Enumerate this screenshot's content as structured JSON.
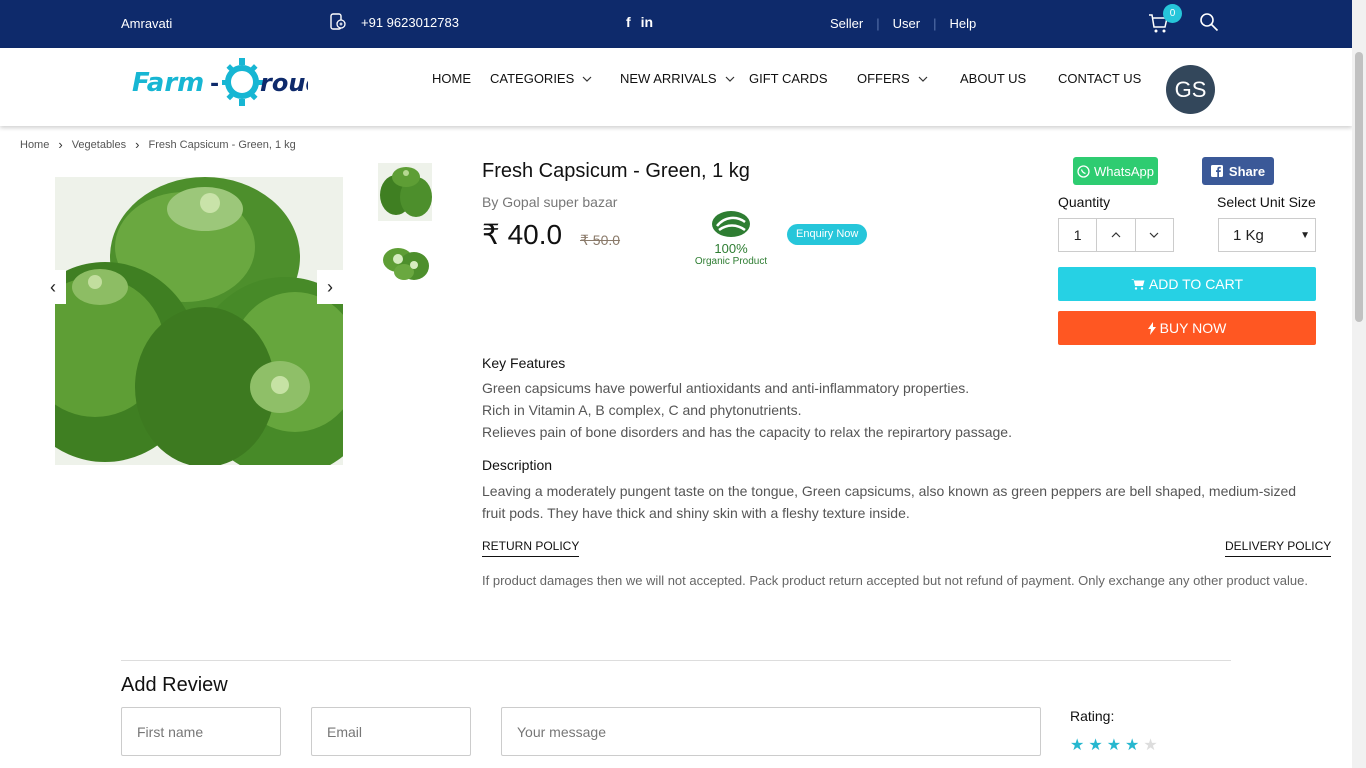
{
  "topbar": {
    "city": "Amravati",
    "phone": "+91 9623012783",
    "social": [
      "f",
      "in"
    ],
    "links": [
      "Seller",
      "User",
      "Help"
    ],
    "cart_count": "0"
  },
  "nav": {
    "items": [
      "HOME",
      "CATEGORIES",
      "NEW ARRIVALS",
      "GIFT CARDS",
      "OFFERS",
      "ABOUT US",
      "CONTACT US"
    ],
    "avatar_initials": "GS",
    "logo_text": "Farm Croud"
  },
  "breadcrumb": [
    "Home",
    "Vegetables",
    "Fresh Capsicum - Green, 1 kg"
  ],
  "product": {
    "title": "Fresh Capsicum - Green, 1 kg",
    "seller": "By Gopal super bazar",
    "price": "₹ 40.0",
    "old_price": "₹ 50.0",
    "organic_pct": "100%",
    "organic_label": "Organic Product",
    "enquiry": "Enquiry Now",
    "whatsapp": "WhatsApp",
    "share": "Share",
    "quantity_label": "Quantity",
    "quantity_value": "1",
    "unit_label": "Select Unit Size",
    "unit_value": "1 Kg",
    "add_to_cart": "ADD TO CART",
    "buy_now": "BUY NOW",
    "key_features_title": "Key Features",
    "key_features": [
      "Green capsicums have powerful antioxidants and anti-inflammatory properties.",
      "Rich in Vitamin A, B complex, C and phytonutrients.",
      "Relieves pain of bone disorders and has the capacity to relax the repirartory passage."
    ],
    "description_title": "Description",
    "description": "Leaving a moderately pungent taste on the tongue, Green capsicums, also known as green peppers are bell shaped, medium-sized fruit pods. They have thick and shiny skin with a fleshy texture inside.",
    "return_policy_tab": "RETURN POLICY",
    "delivery_policy_tab": "DELIVERY POLICY",
    "return_policy_text": "If product damages then we will not accepted. Pack product return accepted but not refund of payment. Only exchange any other product value."
  },
  "review": {
    "title": "Add Review",
    "first_name_placeholder": "First name",
    "email_placeholder": "Email",
    "message_placeholder": "Your message",
    "rating_label": "Rating:",
    "rating_value": 4,
    "rating_max": 5
  },
  "colors": {
    "topbar": "#0e2a6b",
    "accent": "#26d1e4",
    "buy": "#ff5722",
    "whatsapp": "#2ecc71",
    "facebook": "#3b5998"
  }
}
